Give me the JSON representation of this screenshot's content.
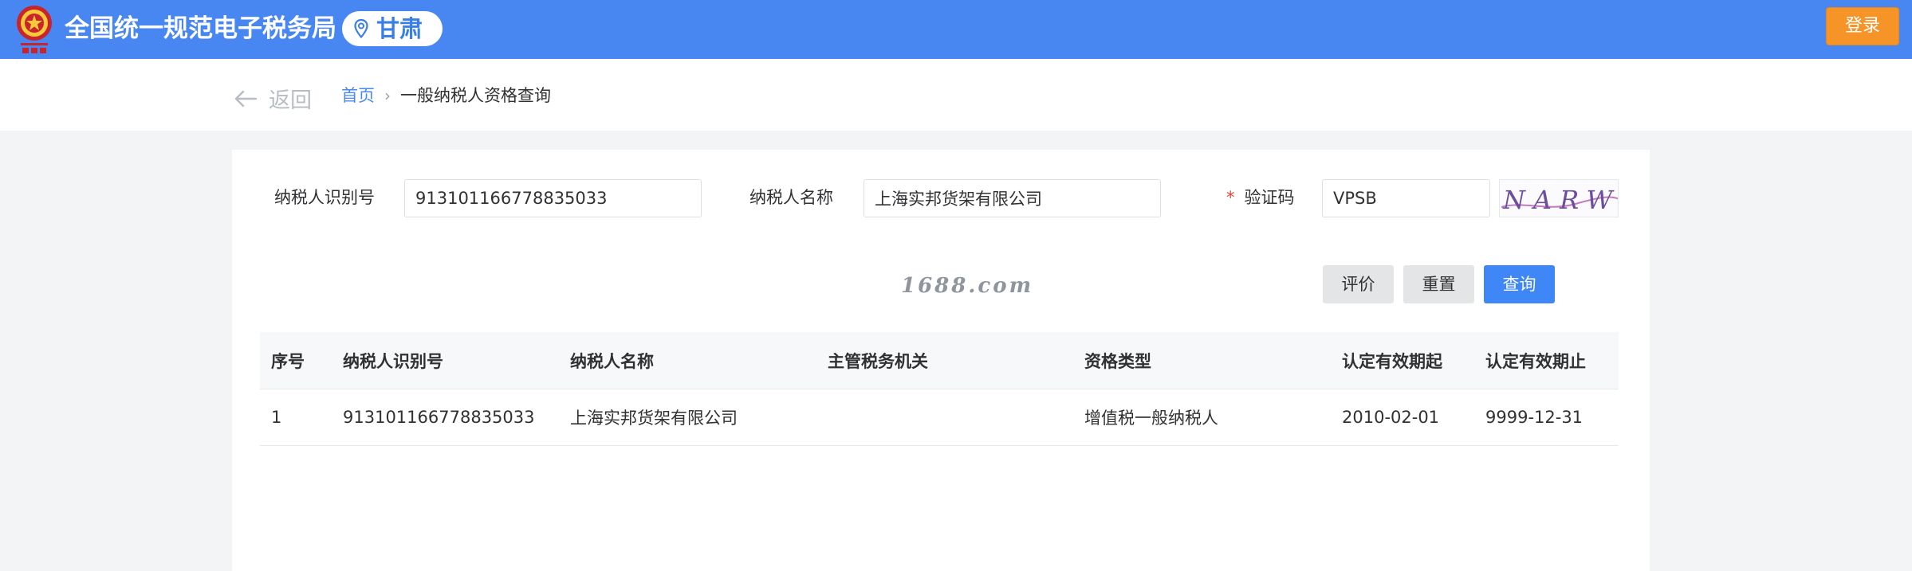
{
  "header": {
    "title": "全国统一规范电子税务局",
    "region": "甘肃",
    "login_label": "登录",
    "logo_icon": "tax-emblem-icon",
    "pin_icon": "location-pin-icon"
  },
  "nav": {
    "back_label": "返回",
    "back_icon": "arrow-left-icon",
    "breadcrumb": {
      "home": "首页",
      "separator": "›",
      "current": "一般纳税人资格查询"
    }
  },
  "form": {
    "taxpayer_id_label": "纳税人识别号",
    "taxpayer_id_value": "913101166778835033",
    "taxpayer_name_label": "纳税人名称",
    "taxpayer_name_value": "上海实邦货架有限公司",
    "required_mark": "*",
    "captcha_label": "验证码",
    "captcha_value": "VPSB",
    "captcha_image_text": "NARW"
  },
  "watermark": "1688.com",
  "buttons": {
    "evaluate": "评价",
    "reset": "重置",
    "query": "查询"
  },
  "table": {
    "headers": [
      "序号",
      "纳税人识别号",
      "纳税人名称",
      "主管税务机关",
      "资格类型",
      "认定有效期起",
      "认定有效期止"
    ],
    "rows": [
      [
        "1",
        "913101166778835033",
        "上海实邦货架有限公司",
        "",
        "增值税一般纳税人",
        "2010-02-01",
        "9999-12-31"
      ]
    ]
  },
  "colors": {
    "header_bg": "#4886f2",
    "login_bg": "#f79428",
    "primary_button": "#3f86f6",
    "link": "#4a8af0"
  }
}
